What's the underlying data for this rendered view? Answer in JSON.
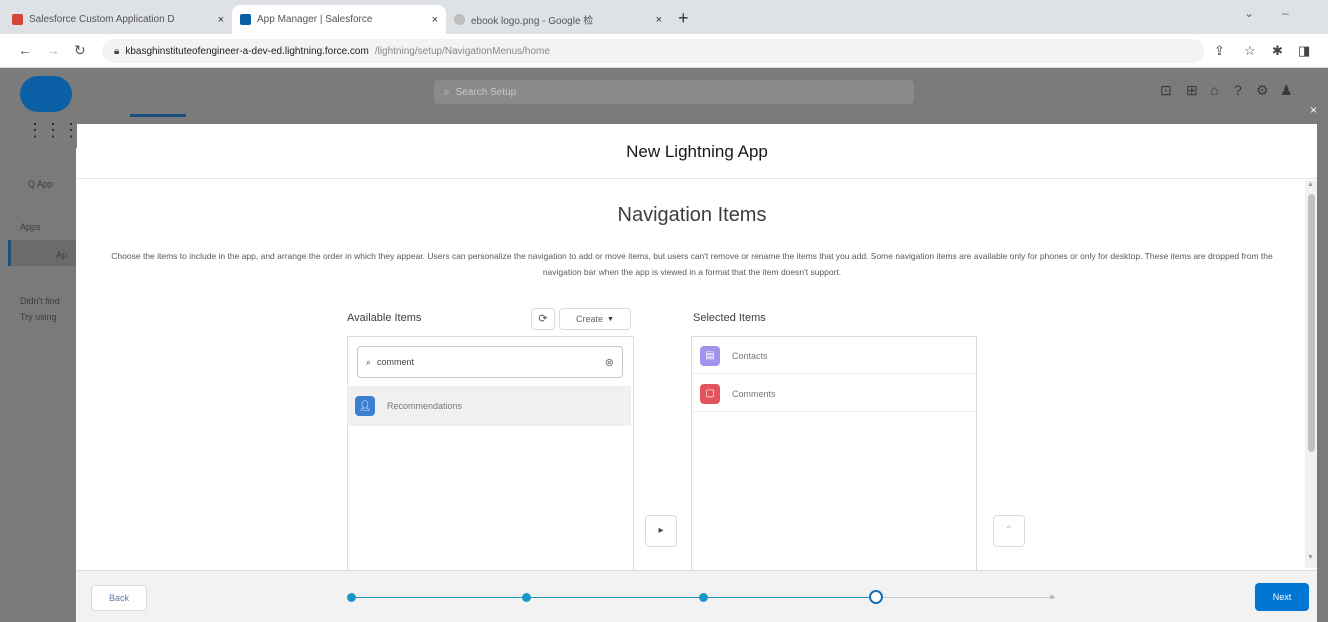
{
  "browser": {
    "tabs": [
      {
        "title": "Salesforce Custom Application D",
        "active": false,
        "favicon_color": "#d44638"
      },
      {
        "title": "App Manager | Salesforce",
        "active": true,
        "favicon_color": "#0b5fa5"
      },
      {
        "title": "ebook logo.png - Google 检",
        "active": false,
        "favicon_color": "#888888"
      }
    ],
    "new_tab_label": "+",
    "close_label": "×",
    "address": {
      "host": "kbasghinstituteofengineer-a-dev-ed.lightning.force.com",
      "path": "/lightning/setup/NavigationMenus/home"
    }
  },
  "salesforce": {
    "search_placeholder": "Search Setup",
    "sidebar_texts": [
      "Q App",
      "Apps",
      "Ap",
      "Didn't find",
      "Try using"
    ]
  },
  "modal": {
    "title": "New Lightning App",
    "step_title": "Navigation Items",
    "description": "Choose the items to include in the app, and arrange the order in which they appear. Users can personalize the navigation to add or move items, but users can't remove or rename the items that you add. Some navigation items are available only for phones or only for desktop. These items are dropped from the navigation bar when the app is viewed in a format that the item doesn't support.",
    "available": {
      "label": "Available Items",
      "create_label": "Create",
      "search_value": "comment",
      "items": [
        {
          "label": "Recommendations",
          "color": "#3c7fd1",
          "icon": "person"
        }
      ]
    },
    "selected": {
      "label": "Selected Items",
      "items": [
        {
          "label": "Contacts",
          "color": "#a094ed",
          "icon": "card"
        },
        {
          "label": "Comments",
          "color": "#e2555f",
          "icon": "comment"
        }
      ]
    },
    "move_right_label": "▸",
    "move_up_label": "⌃",
    "footer": {
      "back_label": "Back",
      "next_label": "Next",
      "progress": {
        "steps": 6,
        "current_step": 5
      }
    }
  },
  "colors": {
    "brand_blue": "#0176d3",
    "progress_blue": "#1b96c8"
  }
}
